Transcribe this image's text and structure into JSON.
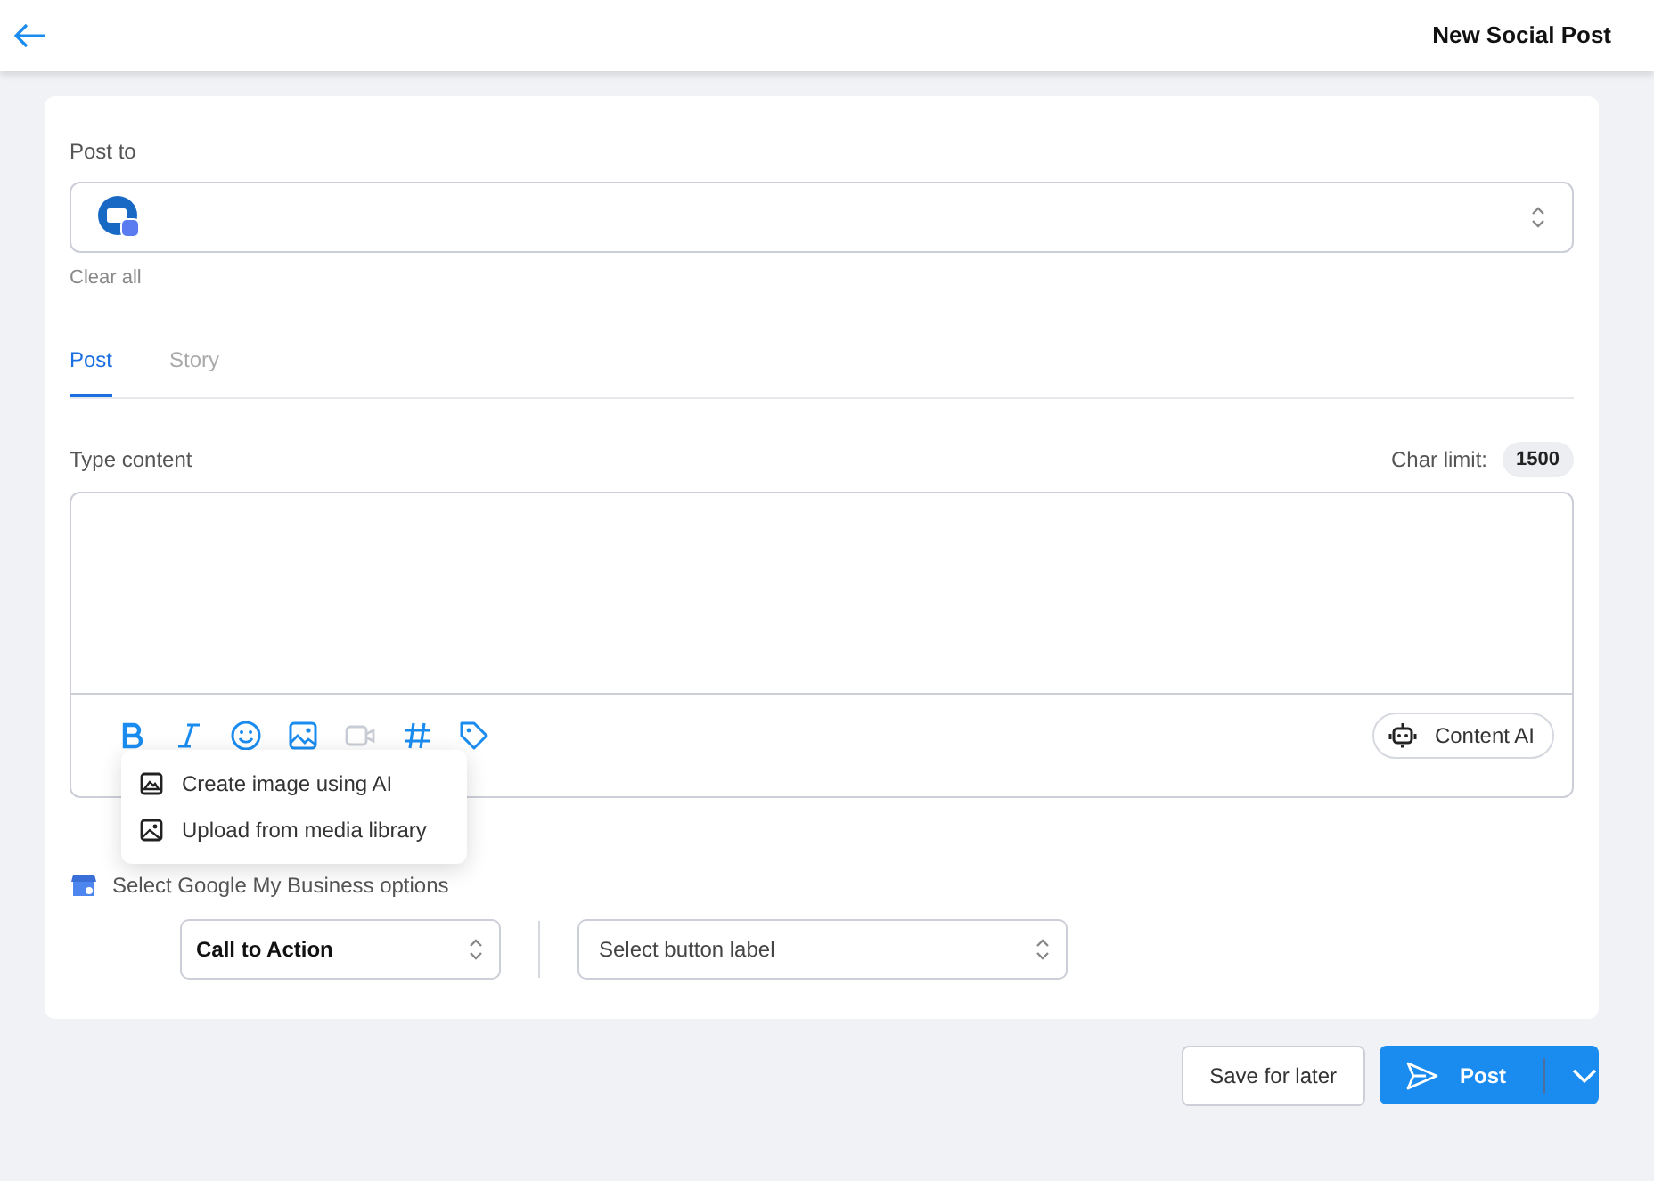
{
  "header": {
    "title": "New Social Post"
  },
  "post_to": {
    "label": "Post to",
    "clear": "Clear all"
  },
  "tabs": [
    {
      "label": "Post",
      "selected": true
    },
    {
      "label": "Story",
      "selected": false
    }
  ],
  "content": {
    "label": "Type content",
    "char_limit_label": "Char limit:",
    "char_limit": "1500"
  },
  "toolbar": [
    {
      "kind": "bold",
      "disabled": false
    },
    {
      "kind": "italic",
      "disabled": false
    },
    {
      "kind": "emoji",
      "disabled": false
    },
    {
      "kind": "image",
      "disabled": false
    },
    {
      "kind": "video",
      "disabled": true
    },
    {
      "kind": "hashtag",
      "disabled": false
    },
    {
      "kind": "tag",
      "disabled": false
    }
  ],
  "content_ai": "Content AI",
  "image_menu": [
    {
      "kind": "ai",
      "label": "Create image using AI"
    },
    {
      "kind": "upload",
      "label": "Upload from media library"
    }
  ],
  "gmb": {
    "label": "Select Google My Business options",
    "action": "Call to Action",
    "button_placeholder": "Select button label"
  },
  "actions": {
    "save": "Save for later",
    "post": "Post"
  }
}
